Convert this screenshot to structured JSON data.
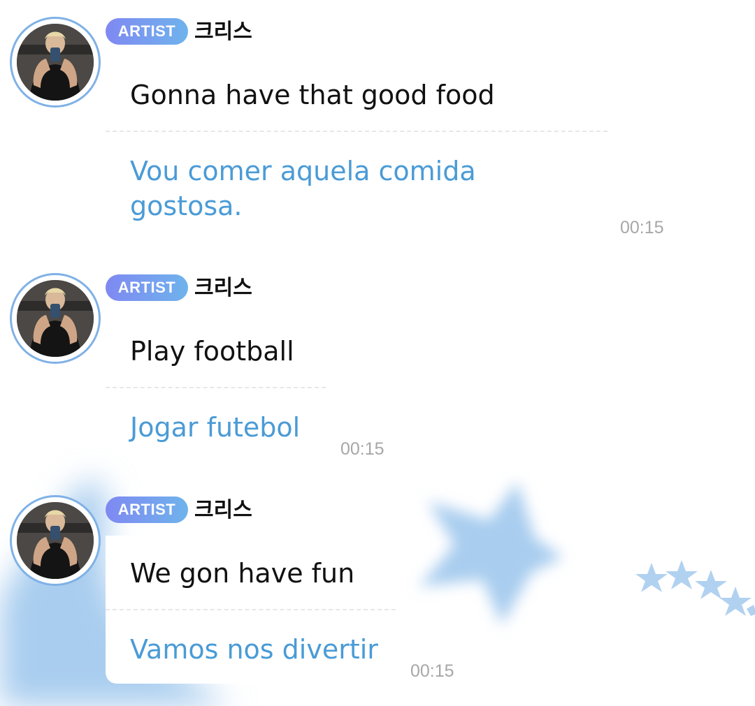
{
  "theme": {
    "accent": "#6fb3ec",
    "badge_start": "#7f89f2",
    "translation_color": "#4a9bd6",
    "star_color": "#a9cdef"
  },
  "messages": [
    {
      "badge": "ARTIST",
      "sender": "크리스",
      "text": "Gonna have that good food",
      "translation": "Vou comer aquela comida gostosa.",
      "time": "00:15"
    },
    {
      "badge": "ARTIST",
      "sender": "크리스",
      "text": "Play football",
      "translation": "Jogar futebol",
      "time": "00:15"
    },
    {
      "badge": "ARTIST",
      "sender": "크리스",
      "text": "We gon have fun",
      "translation": "Vamos nos divertir",
      "time": "00:15"
    }
  ]
}
